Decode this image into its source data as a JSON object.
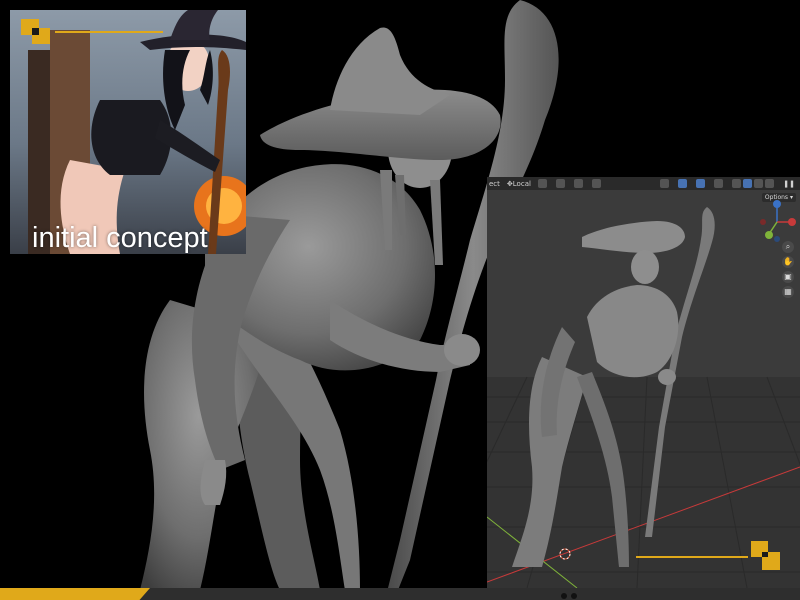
{
  "concept": {
    "caption": "initial concept"
  },
  "viewport": {
    "header": {
      "select_label": "ect",
      "orientation_label": "Local"
    },
    "options_label": "Options",
    "tools": [
      {
        "name": "zoom-icon",
        "glyph": "⌕"
      },
      {
        "name": "pan-hand-icon",
        "glyph": "✋"
      },
      {
        "name": "camera-icon",
        "glyph": "▣"
      },
      {
        "name": "grid-toggle-icon",
        "glyph": "▦"
      }
    ]
  },
  "colors": {
    "accent": "#e0a91a",
    "background": "#000000",
    "viewport_bg": "#3b3b3b",
    "viewport_header": "#2a2a2a",
    "bottom_bar": "#2e2e2e",
    "axis_x": "#c73a3a",
    "axis_y": "#7fb33a",
    "axis_z": "#3a72c7"
  }
}
